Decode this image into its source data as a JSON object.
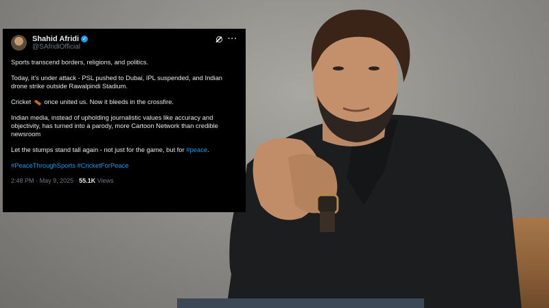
{
  "tweet": {
    "display_name": "Shahid Afridi",
    "handle": "@SAfridiOfficial",
    "verified_icon": "verified-badge-icon",
    "paragraphs": {
      "p1": "Sports transcend borders, religions, and politics.",
      "p2": "Today, it’s under attack - PSL pushed to Dubai, IPL suspended, and Indian drone strike outside Rawalpindi Stadium.",
      "p3a": "Cricket",
      "p3b": "once united us. Now it bleeds in the crossfire.",
      "p4": "Indian media, instead of upholding journalistic values like accuracy and objectivity, has turned into a parody, more Cartoon Network than credible newsroom",
      "p5a": "Let the stumps stand tall again - not just for the game, but for",
      "p5_hashtag": "#peace",
      "p5b": ".",
      "hashtags": "#PeaceThroughSports #CricketForPeace"
    },
    "time": "2:48 PM",
    "separator": "·",
    "date": "May 9, 2025",
    "views_count": "55.1K",
    "views_label": "Views",
    "colors": {
      "background": "#000000",
      "text": "#e7e9ea",
      "muted": "#71767b",
      "accent": "#1d9bf0"
    }
  }
}
